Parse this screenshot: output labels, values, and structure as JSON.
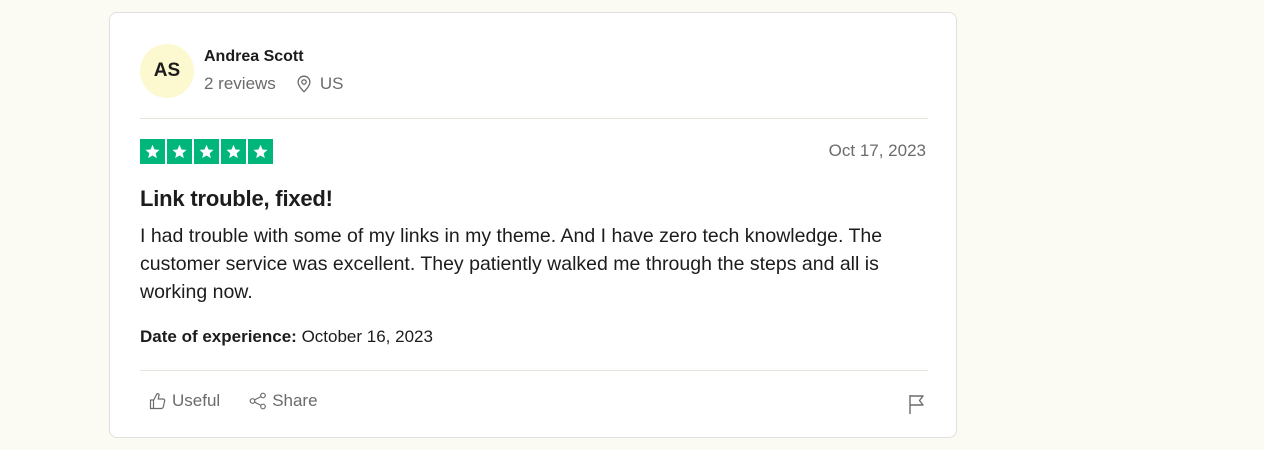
{
  "review": {
    "consumer": {
      "initials": "AS",
      "name": "Andrea Scott",
      "reviews_count": "2 reviews",
      "location": "US",
      "location_icon": "map-pin-icon"
    },
    "rating": {
      "stars": 5,
      "max": 5,
      "color": "#00b67a"
    },
    "date": "Oct 17, 2023",
    "title": "Link trouble, fixed!",
    "body": "I had trouble with some of my links in my theme. And I have zero tech knowledge. The customer service was excellent. They patiently walked me through the steps and all is working now.",
    "experience_label": "Date of experience:",
    "experience_date": "October 16, 2023",
    "actions": {
      "useful_label": "Useful",
      "useful_icon": "thumbs-up-icon",
      "share_label": "Share",
      "share_icon": "share-icon",
      "flag_icon": "flag-icon"
    }
  },
  "colors": {
    "page_background": "#fbfaf3",
    "avatar_background": "#fcf8cf",
    "star_green": "#00b67a",
    "muted_text": "#6b6b6b"
  }
}
